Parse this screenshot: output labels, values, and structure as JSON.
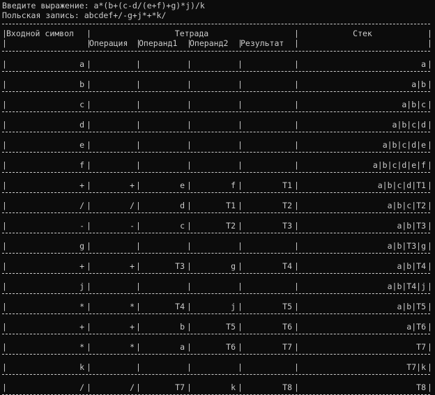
{
  "console": {
    "prompt_line": "Введите выражение: a*(b+(c-d/(e+f)+g)*j)/k",
    "polish_line": "Польская запись: abcdef+/-g+j*+*k/"
  },
  "table": {
    "header": {
      "input_symbol": "Входной символ",
      "tetrad": "Тетрада",
      "stack": "Стек",
      "operation": "Операция",
      "operand1": "Операнд1",
      "operand2": "Операнд2",
      "result": "Результат"
    },
    "rows": [
      {
        "sym": "a",
        "op": "",
        "o1": "",
        "o2": "",
        "res": "",
        "stack": "a"
      },
      {
        "sym": "b",
        "op": "",
        "o1": "",
        "o2": "",
        "res": "",
        "stack": "a|b"
      },
      {
        "sym": "c",
        "op": "",
        "o1": "",
        "o2": "",
        "res": "",
        "stack": "a|b|c"
      },
      {
        "sym": "d",
        "op": "",
        "o1": "",
        "o2": "",
        "res": "",
        "stack": "a|b|c|d"
      },
      {
        "sym": "e",
        "op": "",
        "o1": "",
        "o2": "",
        "res": "",
        "stack": "a|b|c|d|e"
      },
      {
        "sym": "f",
        "op": "",
        "o1": "",
        "o2": "",
        "res": "",
        "stack": "a|b|c|d|e|f"
      },
      {
        "sym": "+",
        "op": "+",
        "o1": "e",
        "o2": "f",
        "res": "T1",
        "stack": "a|b|c|d|T1"
      },
      {
        "sym": "/",
        "op": "/",
        "o1": "d",
        "o2": "T1",
        "res": "T2",
        "stack": "a|b|c|T2"
      },
      {
        "sym": "-",
        "op": "-",
        "o1": "c",
        "o2": "T2",
        "res": "T3",
        "stack": "a|b|T3"
      },
      {
        "sym": "g",
        "op": "",
        "o1": "",
        "o2": "",
        "res": "",
        "stack": "a|b|T3|g"
      },
      {
        "sym": "+",
        "op": "+",
        "o1": "T3",
        "o2": "g",
        "res": "T4",
        "stack": "a|b|T4"
      },
      {
        "sym": "j",
        "op": "",
        "o1": "",
        "o2": "",
        "res": "",
        "stack": "a|b|T4|j"
      },
      {
        "sym": "*",
        "op": "*",
        "o1": "T4",
        "o2": "j",
        "res": "T5",
        "stack": "a|b|T5"
      },
      {
        "sym": "+",
        "op": "+",
        "o1": "b",
        "o2": "T5",
        "res": "T6",
        "stack": "a|T6"
      },
      {
        "sym": "*",
        "op": "*",
        "o1": "a",
        "o2": "T6",
        "res": "T7",
        "stack": "T7"
      },
      {
        "sym": "k",
        "op": "",
        "o1": "",
        "o2": "",
        "res": "",
        "stack": "T7|k"
      },
      {
        "sym": "/",
        "op": "/",
        "o1": "T7",
        "o2": "k",
        "res": "T8",
        "stack": "T8"
      }
    ]
  }
}
